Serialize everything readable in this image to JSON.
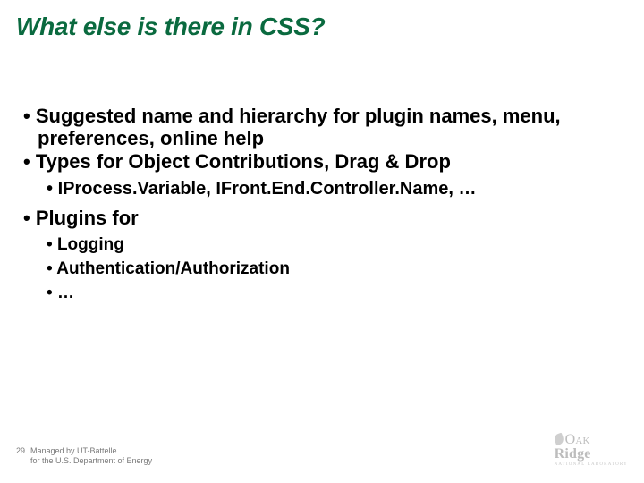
{
  "title": "What else is there in CSS?",
  "bullets": {
    "b1": "Suggested name and hierarchy for plugin names, menu, preferences, online help",
    "b2": "Types for Object Contributions, Drag & Drop",
    "b2_sub1": "IProcess.Variable, IFront.End.Controller.Name, …",
    "b3": "Plugins for",
    "b3_sub1": "Logging",
    "b3_sub2": "Authentication/Authorization",
    "b3_sub3": "…"
  },
  "footer": {
    "page_num": "29",
    "line1": "Managed by UT-Battelle",
    "line2": "for the U.S. Department of Energy"
  },
  "logo": {
    "oak": "Oak",
    "ridge": "Ridge",
    "sub": "NATIONAL LABORATORY"
  }
}
